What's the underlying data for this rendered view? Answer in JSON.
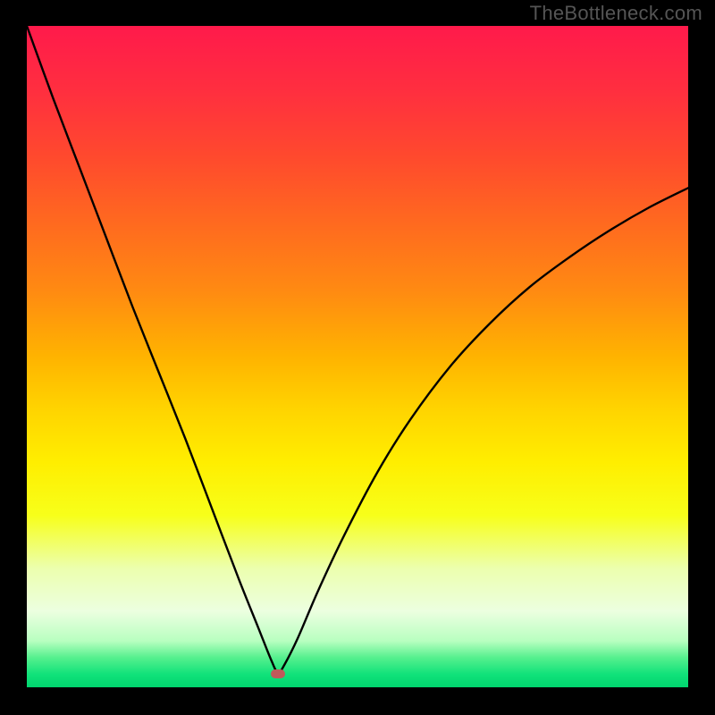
{
  "watermark": "TheBottleneck.com",
  "colors": {
    "frame_border": "#000000",
    "curve": "#000000",
    "marker": "#c15a5a",
    "watermark_text": "#555555"
  },
  "gradient_stops": [
    {
      "offset": 0.0,
      "color": "#ff1a4b"
    },
    {
      "offset": 0.1,
      "color": "#ff2f3f"
    },
    {
      "offset": 0.2,
      "color": "#ff4a2d"
    },
    {
      "offset": 0.3,
      "color": "#ff6a1f"
    },
    {
      "offset": 0.4,
      "color": "#ff8a12"
    },
    {
      "offset": 0.5,
      "color": "#ffb300"
    },
    {
      "offset": 0.58,
      "color": "#ffd400"
    },
    {
      "offset": 0.66,
      "color": "#ffee00"
    },
    {
      "offset": 0.74,
      "color": "#f7ff1a"
    },
    {
      "offset": 0.82,
      "color": "#ecffae"
    },
    {
      "offset": 0.885,
      "color": "#ecffe0"
    },
    {
      "offset": 0.93,
      "color": "#b8ffc0"
    },
    {
      "offset": 0.955,
      "color": "#56f08e"
    },
    {
      "offset": 0.98,
      "color": "#11e27a"
    },
    {
      "offset": 1.0,
      "color": "#00d56e"
    }
  ],
  "chart_data": {
    "type": "line",
    "title": "",
    "xlabel": "",
    "ylabel": "",
    "xlim": [
      0,
      100
    ],
    "ylim": [
      0,
      100
    ],
    "legend": false,
    "grid": false,
    "minimum_point": {
      "x": 38,
      "y": 2
    },
    "series": [
      {
        "name": "bottleneck-curve",
        "x": [
          0,
          4,
          8,
          12,
          16,
          20,
          24,
          28,
          32,
          35,
          37,
          38,
          39,
          41,
          44,
          48,
          53,
          58,
          64,
          70,
          76,
          82,
          88,
          94,
          100
        ],
        "y": [
          100,
          89,
          78.5,
          68,
          57.5,
          47.5,
          37.5,
          27,
          16.5,
          9,
          4,
          2.2,
          3.5,
          7.5,
          14.5,
          23,
          32.5,
          40.5,
          48.5,
          55,
          60.5,
          65,
          69,
          72.5,
          75.5
        ]
      }
    ]
  }
}
